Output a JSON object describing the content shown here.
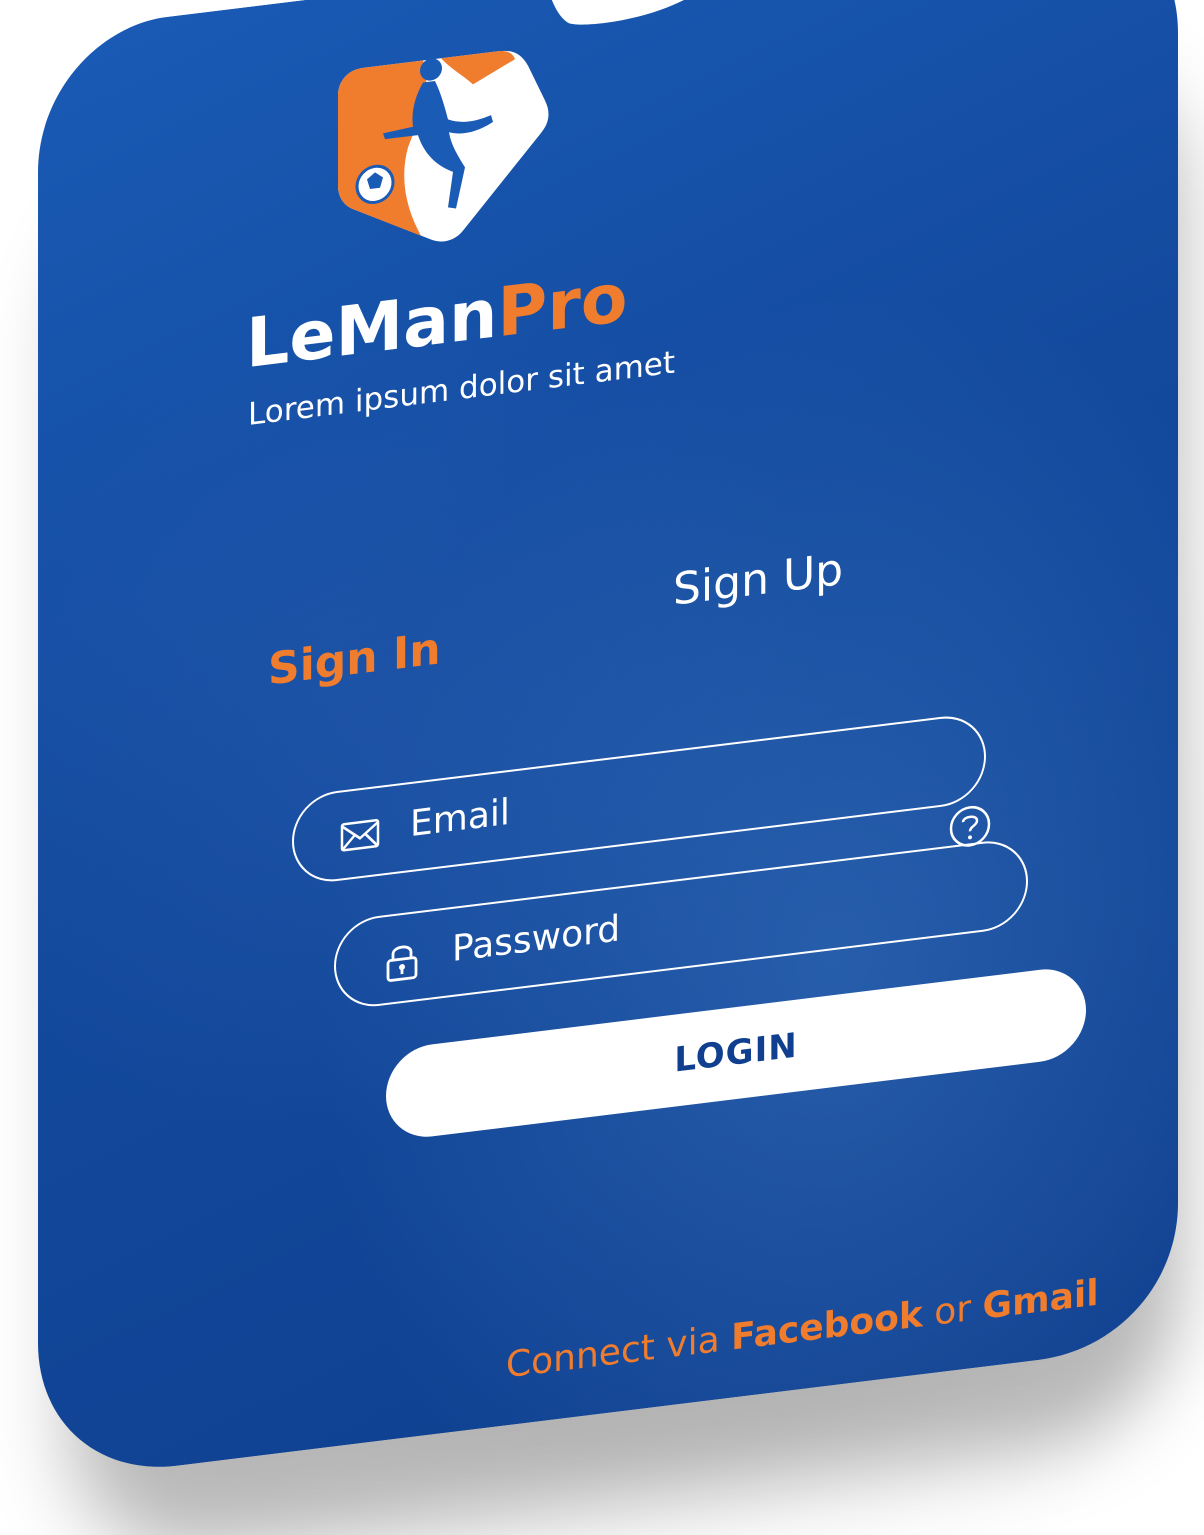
{
  "app": {
    "brand_first": "LeMan",
    "brand_second": "Pro",
    "tagline": "Lorem ipsum dolor sit amet"
  },
  "tabs": {
    "sign_in": "Sign In",
    "sign_up": "Sign Up"
  },
  "form": {
    "email_placeholder": "Email",
    "password_placeholder": "Password",
    "login_label": "LOGIN"
  },
  "connect": {
    "prefix": "Connect via ",
    "facebook": "Facebook",
    "middle": " or ",
    "gmail": "Gmail"
  },
  "colors": {
    "background_blue": "#134a9e",
    "accent_orange": "#f07c2e",
    "white": "#ffffff",
    "button_text": "#0f3f8e"
  },
  "icons": {
    "logo": "soccer-player-logo",
    "email": "envelope-icon",
    "password": "lock-icon",
    "help": "question-circle-icon"
  }
}
